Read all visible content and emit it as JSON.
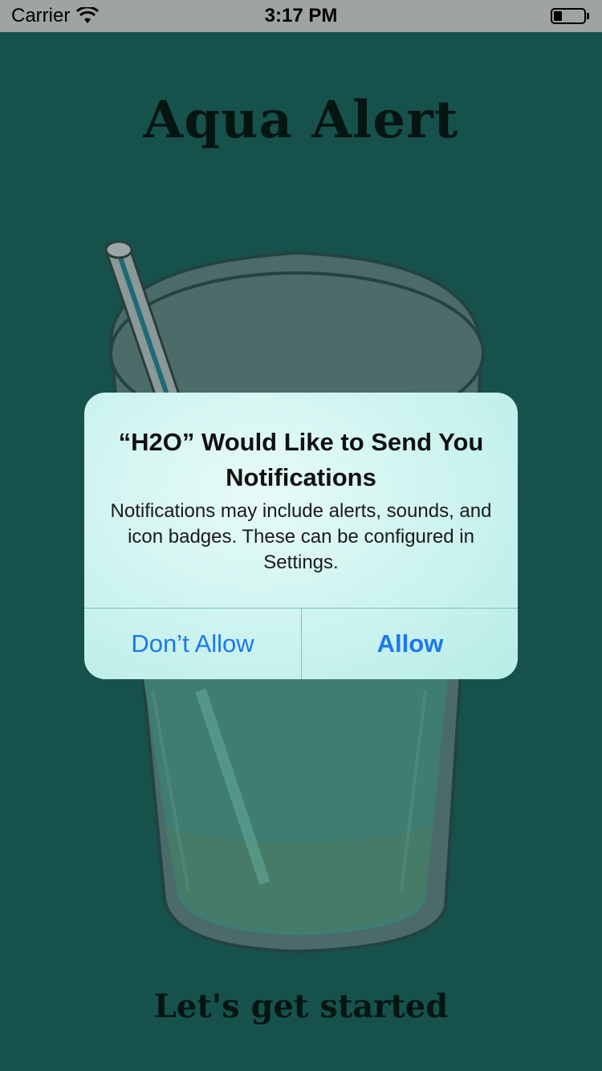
{
  "status_bar": {
    "carrier": "Carrier",
    "time": "3:17 PM",
    "icons": [
      "wifi-icon",
      "battery-icon"
    ]
  },
  "app": {
    "title": "Aqua Alert",
    "cta": "Let's get started"
  },
  "illustration": {
    "subject": "glass-with-straw-icon",
    "colors": {
      "background": "#16524b",
      "glass": "#4a6b69",
      "liquid": "#3f7d72",
      "straw": "#8c9c9a"
    }
  },
  "alert": {
    "title": "“H2O” Would Like to Send You Notifications",
    "message": "Notifications may include alerts, sounds, and icon badges. These can be configured in Settings.",
    "buttons": {
      "deny": "Don’t Allow",
      "allow": "Allow"
    },
    "accent": "#1d77f0"
  }
}
